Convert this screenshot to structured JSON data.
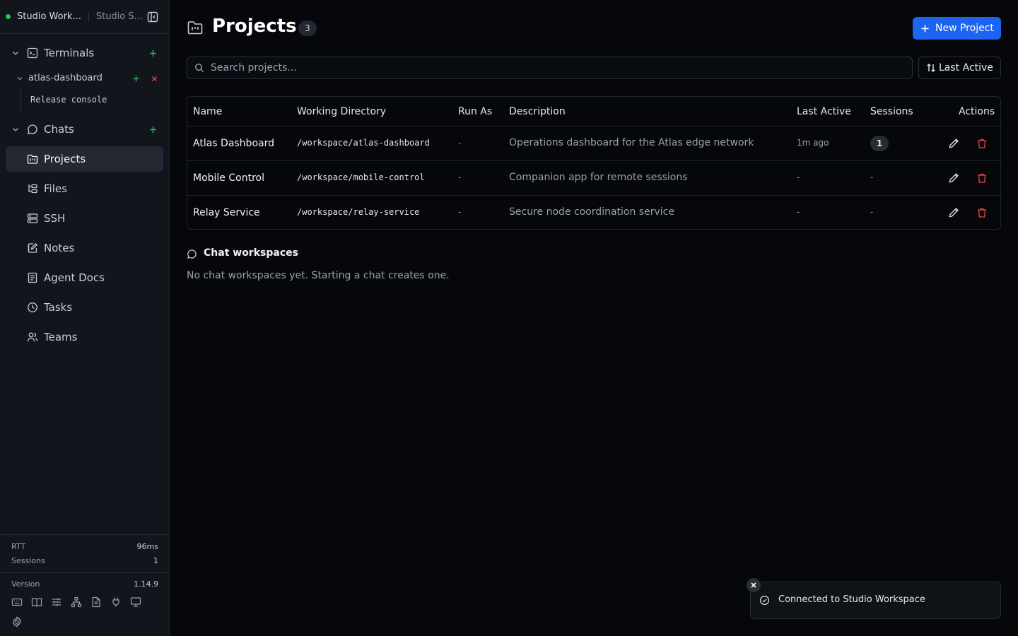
{
  "sidebar": {
    "workspace_name": "Studio Work...",
    "workspace_alt": "Studio S...",
    "groups": {
      "terminals": {
        "label": "Terminals",
        "icon": "terminal-icon"
      },
      "chats": {
        "label": "Chats",
        "icon": "chat-icon"
      }
    },
    "terminal_session": {
      "label": "atlas-dashboard",
      "child": "Release console"
    },
    "nav": [
      {
        "label": "Projects",
        "icon": "folder-kanban-icon",
        "active": true
      },
      {
        "label": "Files",
        "icon": "folder-tree-icon"
      },
      {
        "label": "SSH",
        "icon": "server-icon"
      },
      {
        "label": "Notes",
        "icon": "notebook-pen-icon"
      },
      {
        "label": "Agent Docs",
        "icon": "book-icon"
      },
      {
        "label": "Tasks",
        "icon": "clock-icon"
      },
      {
        "label": "Teams",
        "icon": "users-icon"
      }
    ],
    "stats": {
      "rtt_label": "RTT",
      "rtt_value": "96ms",
      "sessions_label": "Sessions",
      "sessions_value": "1",
      "version_label": "Version",
      "version_value": "1.14.9"
    },
    "status_color": "#22c55e"
  },
  "header": {
    "title": "Projects",
    "count": "3",
    "new_button": "New Project"
  },
  "search": {
    "placeholder": "Search projects...",
    "value": ""
  },
  "sort": {
    "label": "Last Active"
  },
  "table": {
    "columns": {
      "name": "Name",
      "dir": "Working Directory",
      "run_as": "Run As",
      "desc": "Description",
      "last": "Last Active",
      "sessions": "Sessions",
      "actions": "Actions"
    },
    "rows": [
      {
        "name": "Atlas Dashboard",
        "dir": "/workspace/atlas-dashboard",
        "run_as": "-",
        "desc": "Operations dashboard for the Atlas edge network",
        "last": "1m ago",
        "sessions": "1"
      },
      {
        "name": "Mobile Control",
        "dir": "/workspace/mobile-control",
        "run_as": "-",
        "desc": "Companion app for remote sessions",
        "last": "-",
        "sessions": "-"
      },
      {
        "name": "Relay Service",
        "dir": "/workspace/relay-service",
        "run_as": "-",
        "desc": "Secure node coordination service",
        "last": "-",
        "sessions": "-"
      }
    ]
  },
  "chat_section": {
    "title": "Chat workspaces",
    "empty": "No chat workspaces yet. Starting a chat creates one."
  },
  "toast": {
    "message": "Connected to Studio Workspace"
  },
  "colors": {
    "accent": "#1d64f2",
    "danger": "#ef4444",
    "success": "#22c55e"
  }
}
